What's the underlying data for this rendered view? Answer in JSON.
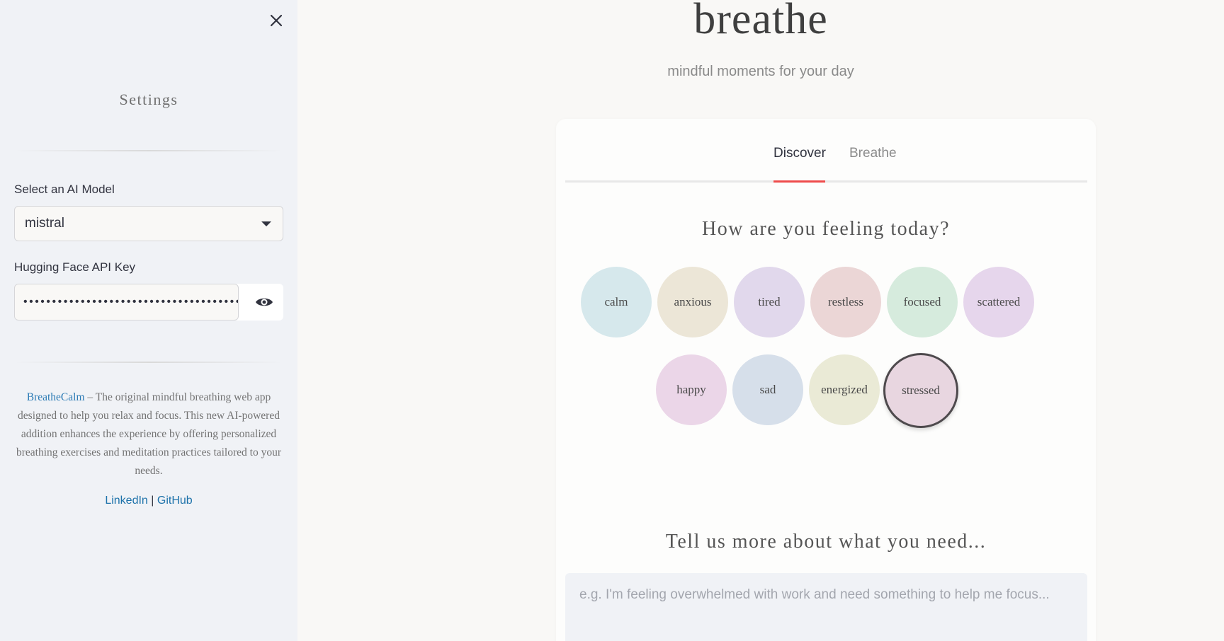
{
  "sidebar": {
    "title": "Settings",
    "model_label": "Select an AI Model",
    "model_value": "mistral",
    "api_key_label": "Hugging Face API Key",
    "api_key_value": "••••••••••••••••••••••••••••••••••••••",
    "about_link": "BreatheCalm",
    "about_text": " – The original mindful breathing web app designed to help you relax and focus. This new AI-powered addition enhances the experience by offering personalized breathing exercises and meditation practices tailored to your needs.",
    "link_linkedin": "LinkedIn",
    "link_separator": " | ",
    "link_github": "GitHub"
  },
  "header": {
    "title": "breathe",
    "subtitle": "mindful moments for your day"
  },
  "tabs": [
    {
      "label": "Discover",
      "active": true
    },
    {
      "label": "Breathe",
      "active": false
    }
  ],
  "discover": {
    "question": "How are you feeling today?",
    "moods": [
      {
        "label": "calm",
        "color": "#d6e8ec"
      },
      {
        "label": "anxious",
        "color": "#ece6d7"
      },
      {
        "label": "tired",
        "color": "#e1d8ec"
      },
      {
        "label": "restless",
        "color": "#ebd6d6"
      },
      {
        "label": "focused",
        "color": "#d6ebdd"
      },
      {
        "label": "scattered",
        "color": "#e6d6ec"
      },
      {
        "label": "happy",
        "color": "#ebd6e8"
      },
      {
        "label": "sad",
        "color": "#d6dfea"
      },
      {
        "label": "energized",
        "color": "#eaead6"
      },
      {
        "label": "stressed",
        "color": "#e8d6e0"
      }
    ],
    "selected_mood": "stressed",
    "more_heading": "Tell us more about what you need...",
    "textarea_placeholder": "e.g. I'm feeling overwhelmed with work and need something to help me focus..."
  },
  "colors": {
    "accent": "#ee4b4b",
    "link": "#1d72aa",
    "sidebar_bg": "#f0f2f6",
    "page_bg": "#f9f8f6"
  }
}
